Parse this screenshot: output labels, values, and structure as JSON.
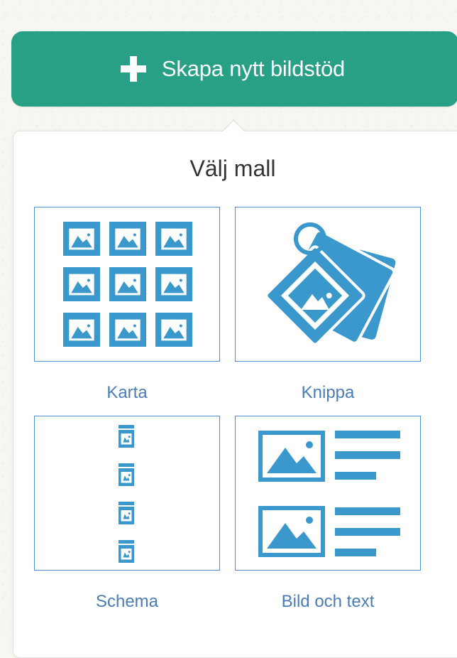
{
  "header": {
    "create_button_label": "Skapa nytt bildstöd",
    "plus_icon": "plus-icon"
  },
  "popover": {
    "title": "Välj mall",
    "templates": [
      {
        "label": "Karta",
        "icon": "grid-images-icon"
      },
      {
        "label": "Knippa",
        "icon": "keyring-cards-icon"
      },
      {
        "label": "Schema",
        "icon": "vertical-schedule-icon"
      },
      {
        "label": "Bild och text",
        "icon": "image-text-icon"
      }
    ]
  },
  "colors": {
    "button_green": "#27a086",
    "icon_blue": "#3a98cc",
    "border_blue": "#4f8fd1",
    "label_blue": "#4a7db8",
    "title_text": "#333333"
  }
}
